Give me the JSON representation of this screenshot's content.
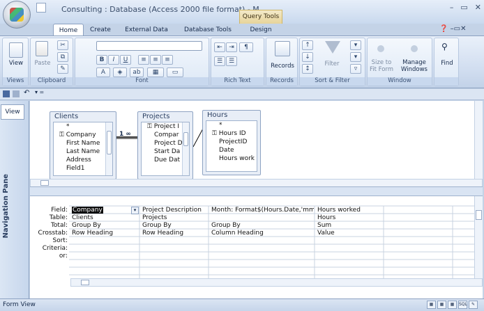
{
  "window": {
    "title": "Consulting : Database (Access 2000 file format) - M..",
    "context_tab": "Query Tools",
    "controls": [
      "–",
      "▭",
      "✕"
    ]
  },
  "ribbon": {
    "tabs": [
      "Home",
      "Create",
      "External Data",
      "Database Tools",
      "Design"
    ],
    "active_tab": "Home",
    "groups": {
      "views": {
        "label": "Views",
        "view_btn": "View"
      },
      "clipboard": {
        "label": "Clipboard",
        "paste_btn": "Paste"
      },
      "font": {
        "label": "Font"
      },
      "rich_text": {
        "label": "Rich Text"
      },
      "records": {
        "label": "Records",
        "records_btn": "Records"
      },
      "sort_filter": {
        "label": "Sort & Filter",
        "filter_btn": "Filter"
      },
      "window": {
        "label": "Window",
        "size_btn": "Size to Fit Form",
        "manage_btn": "Manage Windows"
      },
      "find": {
        "label": "",
        "find_btn": "Find"
      }
    }
  },
  "nav": {
    "view_tab": "View",
    "pane_label": "Navigation Pane"
  },
  "tables": [
    {
      "title": "Clients",
      "fields": [
        "*",
        "Company",
        "First Name",
        "Last Name",
        "Address",
        "Field1"
      ],
      "key_field": 1
    },
    {
      "title": "Projects",
      "fields": [
        "Project I",
        "Compar",
        "Project D",
        "Start Da",
        "Due Dat"
      ],
      "key_field": 0
    },
    {
      "title": "Hours",
      "fields": [
        "*",
        "Hours ID",
        "ProjectID",
        "Date",
        "Hours work"
      ],
      "key_field": 1
    }
  ],
  "relationship": {
    "one": "1",
    "many": "∞"
  },
  "grid": {
    "row_labels": [
      "Field:",
      "Table:",
      "Total:",
      "Crosstab:",
      "Sort:",
      "Criteria:",
      "or:"
    ],
    "columns": [
      {
        "field": "Company",
        "table": "Clients",
        "total": "Group By",
        "crosstab": "Row Heading"
      },
      {
        "field": "Project Description",
        "table": "Projects",
        "total": "Group By",
        "crosstab": "Row Heading"
      },
      {
        "field": "Month: Format$(Hours.Date,'mmm",
        "table": "",
        "total": "Group By",
        "crosstab": "Column Heading"
      },
      {
        "field": "Hours worked",
        "table": "Hours",
        "total": "Sum",
        "crosstab": "Value"
      }
    ]
  },
  "status": {
    "text": "Form View",
    "sql_label": "SQL"
  }
}
